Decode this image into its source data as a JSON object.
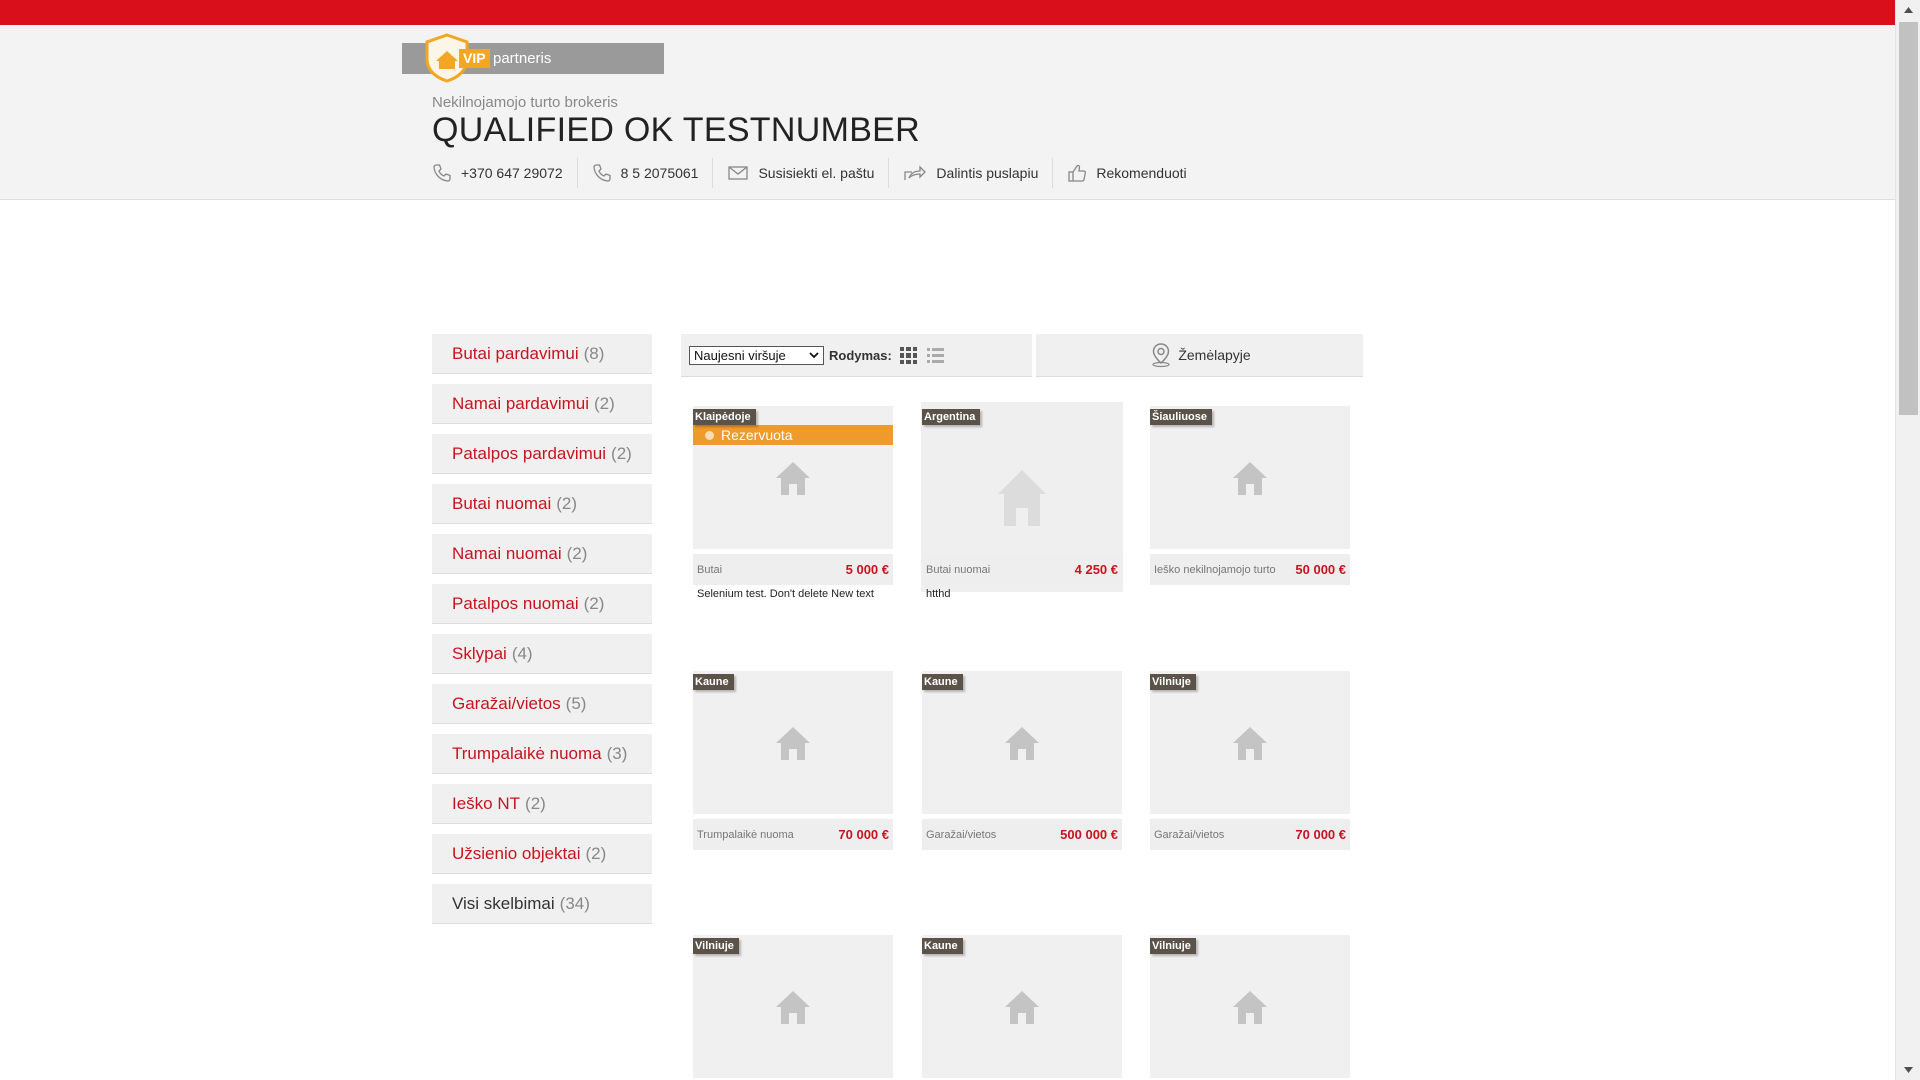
{
  "header": {
    "vip_badge": "VIP",
    "vip_label": "partneris",
    "broker_subtitle": "Nekilnojamojo turto brokeris",
    "broker_name": "QUALIFIED OK TESTNUMBER",
    "contacts": [
      {
        "icon": "phone-icon",
        "label": "+370 647 29072"
      },
      {
        "icon": "phone-icon",
        "label": "8 5 2075061"
      },
      {
        "icon": "mail-icon",
        "label": "Susisiekti el. paštu"
      },
      {
        "icon": "share-icon",
        "label": "Dalintis puslapiu"
      },
      {
        "icon": "thumbs-up-icon",
        "label": "Rekomenduoti"
      }
    ]
  },
  "sidebar": {
    "categories": [
      {
        "label": "Butai pardavimui",
        "count": "(8)"
      },
      {
        "label": "Namai pardavimui",
        "count": "(2)"
      },
      {
        "label": "Patalpos pardavimui",
        "count": "(2)"
      },
      {
        "label": "Butai nuomai",
        "count": "(2)"
      },
      {
        "label": "Namai nuomai",
        "count": "(2)"
      },
      {
        "label": "Patalpos nuomai",
        "count": "(2)"
      },
      {
        "label": "Sklypai",
        "count": "(4)"
      },
      {
        "label": "Garažai/vietos",
        "count": "(5)"
      },
      {
        "label": "Trumpalaikė nuoma",
        "count": "(3)"
      },
      {
        "label": "Ieško NT",
        "count": "(2)"
      },
      {
        "label": "Užsienio objektai",
        "count": "(2)"
      },
      {
        "label": "Visi skelbimai",
        "count": "(34)"
      }
    ]
  },
  "toolbar": {
    "sort_selected": "Naujesni viršuje",
    "view_label": "Rodymas:",
    "map_label": "Žemėlapyje"
  },
  "listings": [
    {
      "tag": "Klaipėdoje",
      "reserved": "Rezervuota",
      "type": "Butai",
      "price": "5 000 €",
      "desc": "Selenium test. Don't delete New text"
    },
    {
      "tag": "Argentina",
      "type": "Butai nuomai",
      "price": "4 250 €",
      "desc": "htthd"
    },
    {
      "tag": "Šiauliuose",
      "type": "Ieško nekilnojamojo turto",
      "price": "50 000 €"
    },
    {
      "tag": "Kaune",
      "type": "Trumpalaikė nuoma",
      "price": "70 000 €"
    },
    {
      "tag": "Kaune",
      "type": "Garažai/vietos",
      "price": "500 000 €"
    },
    {
      "tag": "Vilniuje",
      "type": "Garažai/vietos",
      "price": "70 000 €"
    },
    {
      "tag": "Vilniuje"
    },
    {
      "tag": "Kaune"
    },
    {
      "tag": "Vilniuje"
    }
  ],
  "colors": {
    "brand_red": "#d90f1c",
    "reserved_orange": "#ee9a2c",
    "vip_gold": "#f2a623"
  }
}
